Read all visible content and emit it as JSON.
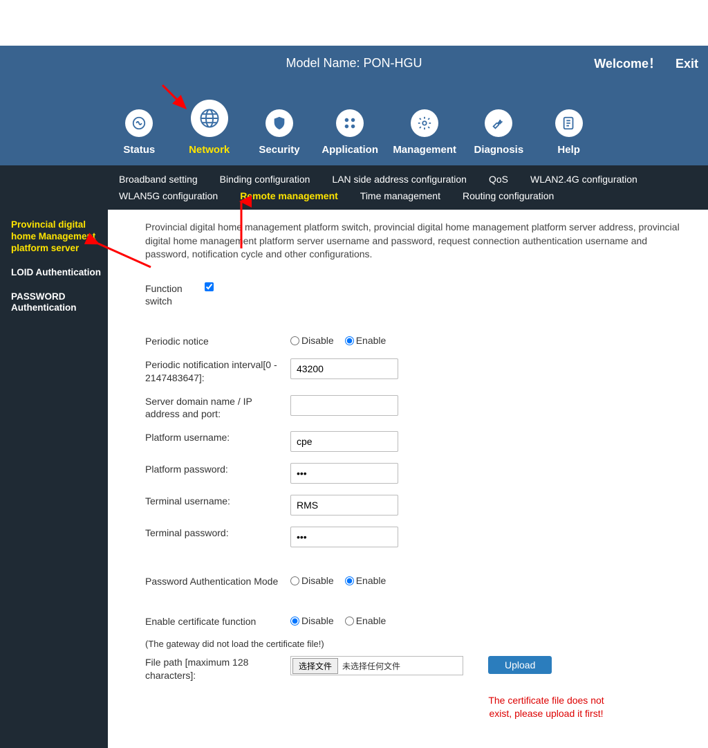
{
  "header": {
    "model_label": "Model Name: PON-HGU",
    "welcome": "Welcome！",
    "exit": "Exit"
  },
  "nav": {
    "items": [
      {
        "label": "Status"
      },
      {
        "label": "Network"
      },
      {
        "label": "Security"
      },
      {
        "label": "Application"
      },
      {
        "label": "Management"
      },
      {
        "label": "Diagnosis"
      },
      {
        "label": "Help"
      }
    ]
  },
  "subnav": {
    "items": [
      "Broadband setting",
      "Binding configuration",
      "LAN side address configuration",
      "QoS",
      "WLAN2.4G configuration",
      "WLAN5G configuration",
      "Remote management",
      "Time management",
      "Routing configuration"
    ],
    "active_index": 6
  },
  "sidebar": {
    "items": [
      "Provincial digital home Management platform server",
      "LOID Authentication",
      "PASSWORD Authentication"
    ],
    "active_index": 0
  },
  "content": {
    "description": "Provincial digital home management platform switch, provincial digital home management platform server address, provincial digital home management platform server username and password, request connection authentication username and password, notification cycle and other configurations.",
    "function_switch_label": "Function switch",
    "periodic_notice_label": "Periodic notice",
    "disable_label": "Disable",
    "enable_label": "Enable",
    "interval_label": "Periodic notification interval[0 - 2147483647]:",
    "interval_value": "43200",
    "server_label": "Server domain name / IP address and port:",
    "server_value": "",
    "platform_user_label": "Platform username:",
    "platform_user_value": "cpe",
    "platform_pass_label": "Platform password:",
    "platform_pass_value": "•••",
    "terminal_user_label": "Terminal username:",
    "terminal_user_value": "RMS",
    "terminal_pass_label": "Terminal password:",
    "terminal_pass_value": "•••",
    "pwd_auth_mode_label": "Password Authentication Mode",
    "cert_enable_label": "Enable certificate function",
    "cert_note": "(The gateway did not load the certificate file!)",
    "file_path_label": "File path [maximum 128 characters]:",
    "file_choose_btn": "选择文件",
    "file_none_text": "未选择任何文件",
    "upload_btn": "Upload",
    "cert_warning": "The certificate file does not exist, please upload it first!"
  }
}
